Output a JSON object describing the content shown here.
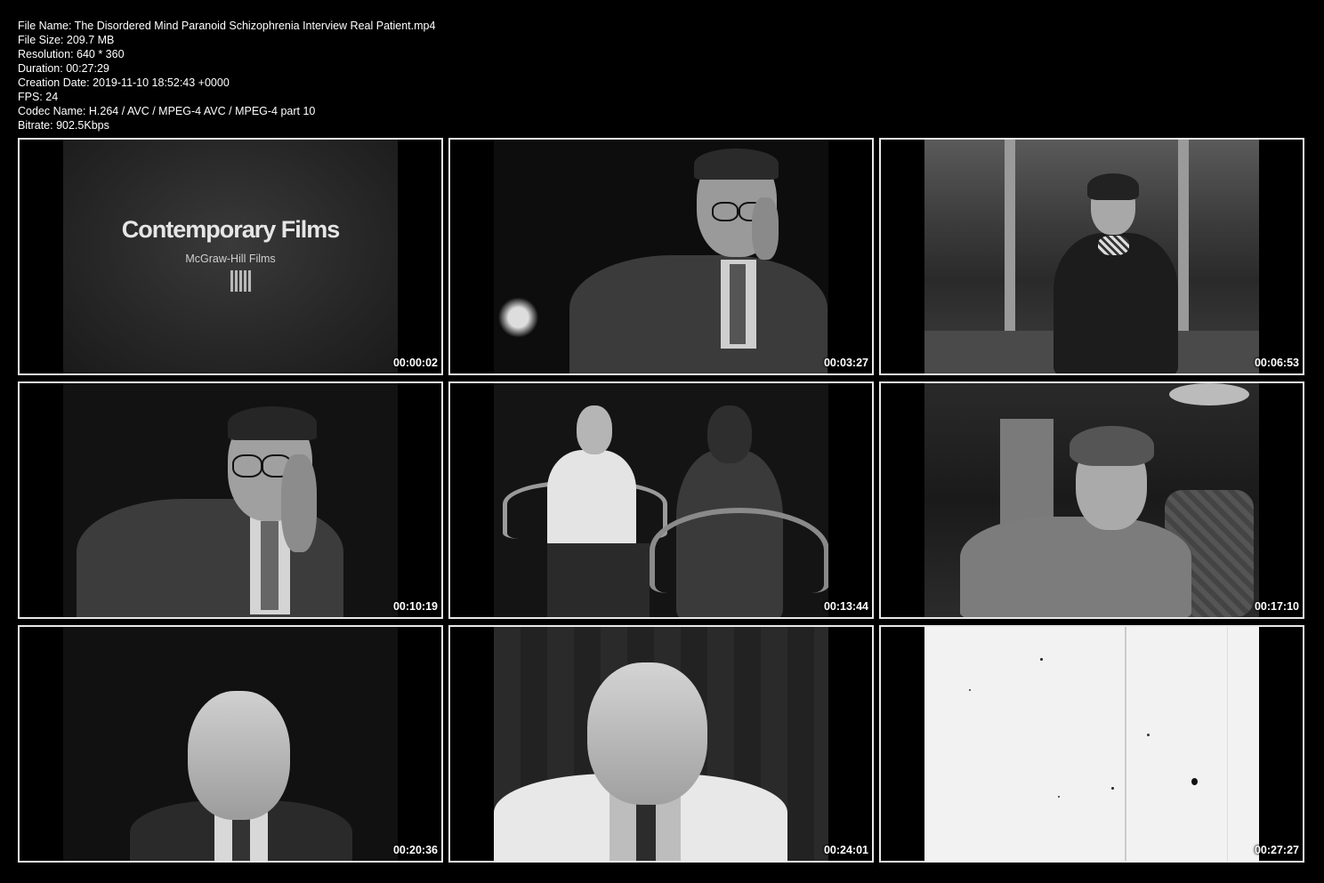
{
  "meta": {
    "file_name": "File Name: The Disordered Mind Paranoid Schizophrenia Interview Real Patient.mp4",
    "file_size": "File Size: 209.7 MB",
    "resolution": "Resolution: 640 * 360",
    "duration": "Duration: 00:27:29",
    "creation_date": "Creation Date: 2019-11-10 18:52:43 +0000",
    "fps": "FPS: 24",
    "codec": "Codec Name: H.264 / AVC / MPEG-4 AVC / MPEG-4 part 10",
    "bitrate": "Bitrate: 902.5Kbps"
  },
  "frame1": {
    "title": "Contemporary Films",
    "subtitle": "McGraw-Hill Films"
  },
  "thumbnails": [
    {
      "timestamp": "00:00:02"
    },
    {
      "timestamp": "00:03:27"
    },
    {
      "timestamp": "00:06:53"
    },
    {
      "timestamp": "00:10:19"
    },
    {
      "timestamp": "00:13:44"
    },
    {
      "timestamp": "00:17:10"
    },
    {
      "timestamp": "00:20:36"
    },
    {
      "timestamp": "00:24:01"
    },
    {
      "timestamp": "00:27:27"
    }
  ]
}
